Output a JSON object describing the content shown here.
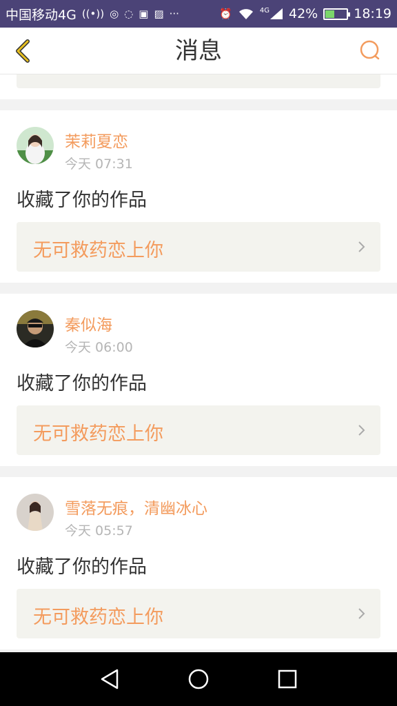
{
  "status_bar": {
    "carrier": "中国移动4G",
    "signal_type": "4G",
    "battery": "42%",
    "battery_level": 0.42,
    "time": "18:19"
  },
  "header": {
    "title": "消息"
  },
  "messages": [
    {
      "username": "茉莉夏恋",
      "time": "今天 07:31",
      "action": "收藏了你的作品",
      "work_title": "无可救药恋上你"
    },
    {
      "username": "秦似海",
      "time": "今天 06:00",
      "action": "收藏了你的作品",
      "work_title": "无可救药恋上你"
    },
    {
      "username": "雪落无痕，清幽冰心",
      "time": "今天 05:57",
      "action": "收藏了你的作品",
      "work_title": "无可救药恋上你"
    }
  ],
  "colors": {
    "accent": "#f39b5d",
    "back_icon": "#e8c020",
    "status_bar": "#4b4377"
  }
}
